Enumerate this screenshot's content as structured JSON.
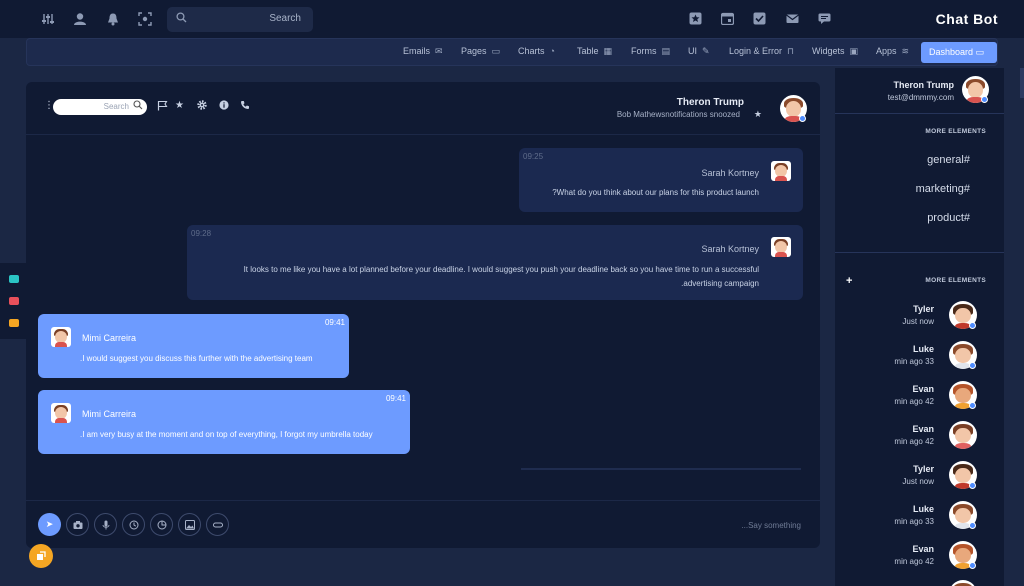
{
  "topbar": {
    "search_placeholder": "Search",
    "brand": "Chat Bot",
    "left_icons": [
      "sliders-icon",
      "user-icon",
      "bell-icon",
      "focus-icon"
    ],
    "right_icons": [
      "star-box-icon",
      "calendar-icon",
      "check-box-icon",
      "mail-icon",
      "chat-icon"
    ]
  },
  "nav": {
    "items": [
      {
        "label": "Emails",
        "icon": "✉"
      },
      {
        "label": "Pages",
        "icon": "▭"
      },
      {
        "label": "Charts",
        "icon": "◔"
      },
      {
        "label": "Table",
        "icon": "▦"
      },
      {
        "label": "Forms",
        "icon": "▤"
      },
      {
        "label": "UI",
        "icon": "✎"
      },
      {
        "label": "Login & Error",
        "icon": "⊓"
      },
      {
        "label": "Widgets",
        "icon": "▣"
      },
      {
        "label": "Apps",
        "icon": "≋"
      }
    ],
    "active": {
      "label": "Dashboard",
      "icon": "▭"
    }
  },
  "chat": {
    "search_placeholder": "Search",
    "contact_name": "Theron Trump",
    "contact_status": "Bob Mathewsnotifications snoozed",
    "messages": [
      {
        "time": "09:25",
        "name": "Sarah Kortney",
        "text": "?What do you think about our plans for this product launch"
      },
      {
        "time": "09:28",
        "name": "Sarah Kortney",
        "text_line1": "It looks to me like you have a lot planned before your deadline. I would suggest you push your deadline back so you have time to run a successful",
        "text_line2": ".advertising campaign"
      },
      {
        "time": "09:41",
        "name": "Mimi Carreira",
        "text": ".I would suggest you discuss this further with the advertising team"
      },
      {
        "time": "09:41",
        "name": "Mimi Carreira",
        "text": ".I am very busy at the moment and on top of everything, I forgot my umbrella today"
      }
    ],
    "input_placeholder": "...Say something",
    "footer_icons": [
      "send-icon",
      "camera-icon",
      "mic-icon",
      "history-icon",
      "image-icon",
      "link-icon"
    ]
  },
  "sidebar": {
    "user_name": "Theron Trump",
    "user_email": "test@dmmmy.com",
    "section1_title": "MORE ELEMENTS",
    "channels": [
      "general#",
      "marketing#",
      "product#"
    ],
    "section2_title": "MORE ELEMENTS",
    "contacts": [
      {
        "name": "Tyler",
        "time": "Just now"
      },
      {
        "name": "Luke",
        "time": "min ago 33"
      },
      {
        "name": "Evan",
        "time": "min ago 42"
      },
      {
        "name": "Evan",
        "time": "min ago 42"
      },
      {
        "name": "Tyler",
        "time": "Just now"
      },
      {
        "name": "Luke",
        "time": "min ago 33"
      },
      {
        "name": "Evan",
        "time": "min ago 42"
      }
    ]
  },
  "colors": {
    "background": "#1b2744",
    "panel": "#101a33",
    "accent": "#6d9bff",
    "bubble_dark": "#1b2950",
    "fab": "#f5a623"
  }
}
